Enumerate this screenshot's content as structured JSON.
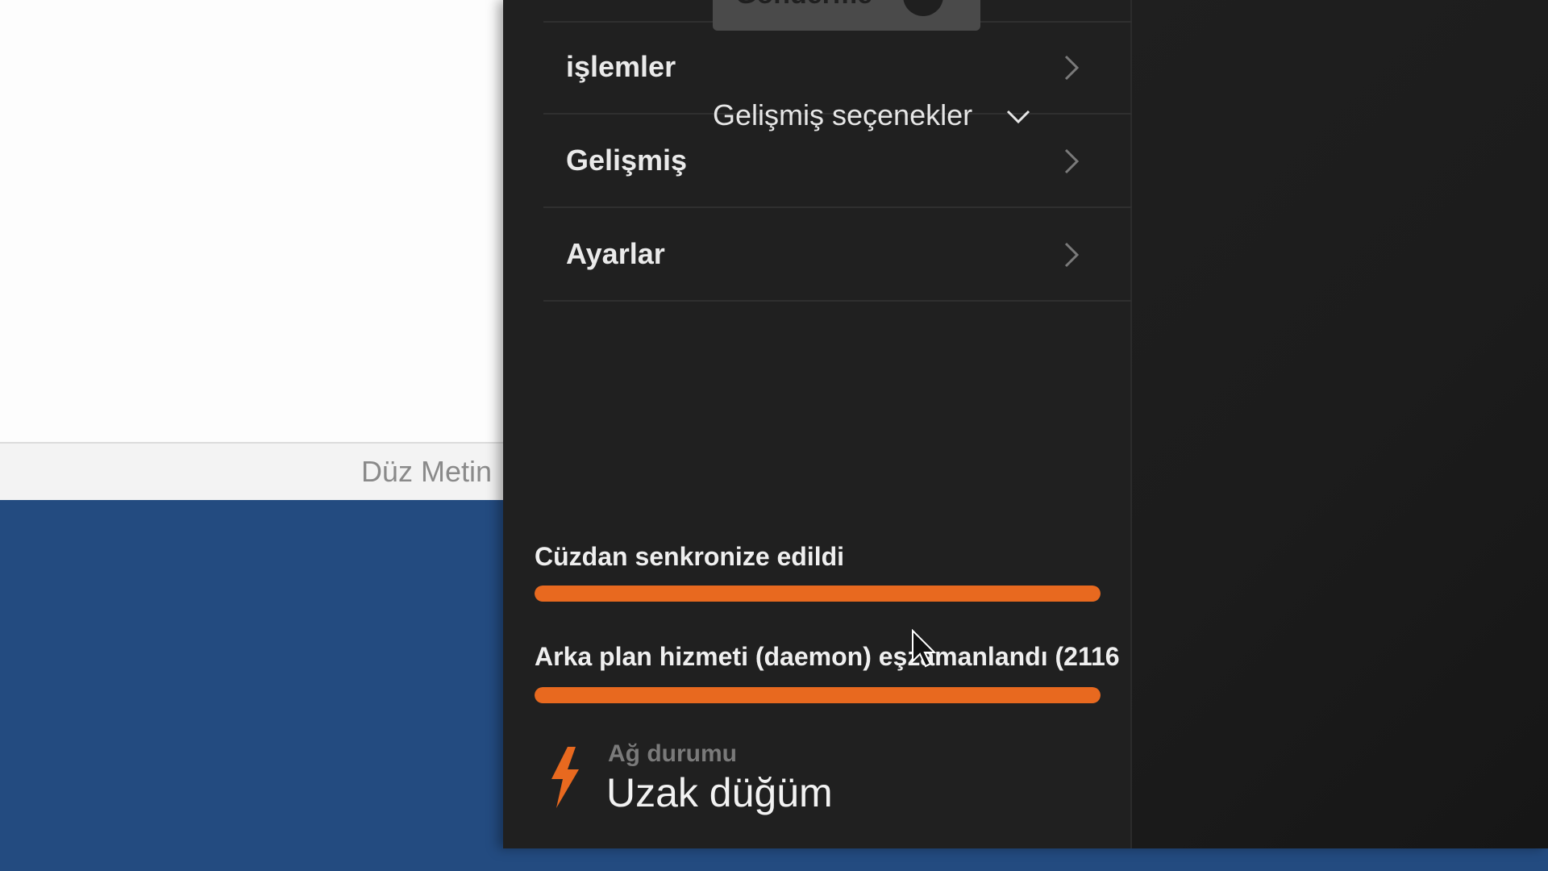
{
  "editor": {
    "status_mode": "Düz Metin"
  },
  "wallet": {
    "menu": [
      {
        "label": "işlemler"
      },
      {
        "label": "Gelişmiş"
      },
      {
        "label": "Ayarlar"
      }
    ],
    "sync": [
      {
        "label": "Cüzdan senkronize edildi",
        "progress": 1.0
      },
      {
        "label": "Arka plan hizmeti (daemon) eşzamanlandı (2116",
        "progress": 1.0
      }
    ],
    "network": {
      "caption": "Ağ durumu",
      "value": "Uzak düğüm",
      "icon": "lightning-icon"
    },
    "send_button": {
      "label": "Gönderme",
      "icon": "arrow-right-icon"
    },
    "advanced_options": {
      "label": "Gelişmiş seçenekler",
      "icon": "chevron-down-icon"
    }
  },
  "colors": {
    "accent": "#e8691f",
    "window_bg": "#202020",
    "desktop_bg": "#234b80"
  }
}
